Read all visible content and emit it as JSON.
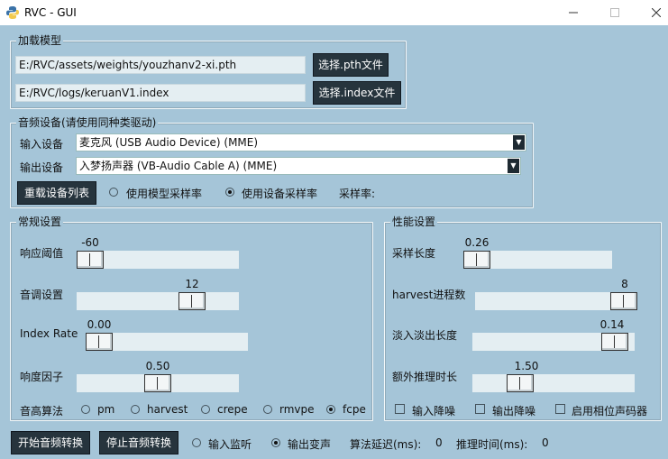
{
  "window": {
    "title": "RVC - GUI",
    "minimize_icon": "minimize-icon",
    "maximize_icon": "maximize-icon",
    "close_icon": "close-icon"
  },
  "load_model": {
    "title": "加载模型",
    "pth_path": "E:/RVC/assets/weights/youzhanv2-xi.pth",
    "pth_button": "选择.pth文件",
    "index_path": "E:/RVC/logs/keruanV1.index",
    "index_button": "选择.index文件"
  },
  "audio_device": {
    "title": "音频设备(请使用同种类驱动)",
    "input_label": "输入设备",
    "input_value": "麦克风 (USB Audio Device) (MME)",
    "output_label": "输出设备",
    "output_value": "入梦扬声器 (VB-Audio Cable A) (MME)",
    "reload_button": "重载设备列表",
    "sr_model_label": "使用模型采样率",
    "sr_device_label": "使用设备采样率",
    "sr_selected": "device",
    "sample_rate_label": "采样率:"
  },
  "general": {
    "title": "常规设置",
    "threshold_label": "响应阈值",
    "threshold_value": "-60",
    "threshold_fraction": 0.0,
    "pitch_label": "音调设置",
    "pitch_value": "12",
    "pitch_fraction": 0.75,
    "index_rate_label": "Index Rate",
    "index_rate_value": "0.00",
    "index_rate_fraction": 0.0,
    "loudness_label": "响度因子",
    "loudness_value": "0.50",
    "loudness_fraction": 0.5,
    "f0_label": "音高算法",
    "f0_methods": [
      "pm",
      "harvest",
      "crepe",
      "rmvpe",
      "fcpe"
    ],
    "f0_selected": "fcpe"
  },
  "performance": {
    "title": "性能设置",
    "block_label": "采样长度",
    "block_value": "0.26",
    "block_fraction": 0.0,
    "harvest_label": "harvest进程数",
    "harvest_value": "8",
    "harvest_fraction": 1.0,
    "crossfade_label": "淡入淡出长度",
    "crossfade_value": "0.14",
    "crossfade_fraction": 0.95,
    "extra_label": "额外推理时长",
    "extra_value": "1.50",
    "extra_fraction": 0.25,
    "noise_in_label": "输入降噪",
    "noise_out_label": "输出降噪",
    "phase_vocoder_label": "启用相位声码器"
  },
  "bottom": {
    "start_button": "开始音频转换",
    "stop_button": "停止音频转换",
    "monitor_in_label": "输入监听",
    "monitor_out_label": "输出变声",
    "monitor_selected": "output",
    "delay_label": "算法延迟(ms):",
    "delay_value": "0",
    "infer_label": "推理时间(ms):",
    "infer_value": "0"
  }
}
